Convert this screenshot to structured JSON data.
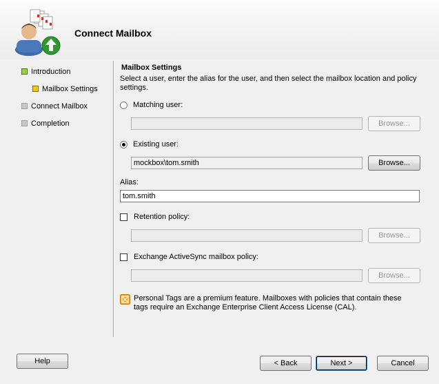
{
  "window": {
    "title": "Connect Mailbox"
  },
  "nav": {
    "items": [
      {
        "label": "Introduction",
        "state": "done"
      },
      {
        "label": "Mailbox Settings",
        "state": "current"
      },
      {
        "label": "Connect Mailbox",
        "state": "pending"
      },
      {
        "label": "Completion",
        "state": "pending"
      }
    ]
  },
  "settings": {
    "heading": "Mailbox Settings",
    "description": "Select a user, enter the alias for the user, and then select the mailbox location and policy settings.",
    "matching_user_label": "Matching user:",
    "matching_user_value": "",
    "existing_user_label": "Existing user:",
    "existing_user_value": "mockbox\\tom.smith",
    "alias_label": "Alias:",
    "alias_value": "tom.smith",
    "retention_label": "Retention policy:",
    "retention_value": "",
    "activesync_label": "Exchange ActiveSync mailbox policy:",
    "activesync_value": "",
    "browse_label": "Browse...",
    "notice": "Personal Tags are a premium feature. Mailboxes with policies that contain these tags require an Exchange Enterprise Client Access License (CAL)."
  },
  "footer": {
    "help": "Help",
    "back": "< Back",
    "next": "Next >",
    "cancel": "Cancel"
  },
  "colors": {
    "done": "#9bd23b",
    "current": "#f5c518",
    "pending": "#c8c8c8",
    "notice_icon": "#f7a21e"
  }
}
